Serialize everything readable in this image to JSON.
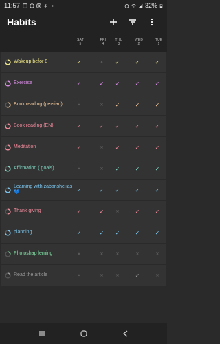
{
  "status_bar": {
    "time": "11:57",
    "battery_text": "32%"
  },
  "app_bar": {
    "title": "Habits"
  },
  "days": [
    {
      "dow": "SAT",
      "num": "5"
    },
    {
      "dow": "FRI",
      "num": "4"
    },
    {
      "dow": "THU",
      "num": "3"
    },
    {
      "dow": "WED",
      "num": "2"
    },
    {
      "dow": "TUE",
      "num": "1"
    }
  ],
  "habits": [
    {
      "name": "Wakeup befor 8",
      "color": "#f3eb8c",
      "progress": 0.75,
      "marks": [
        1,
        0,
        1,
        1,
        1
      ]
    },
    {
      "name": "Exercise",
      "color": "#d98ce6",
      "progress": 0.8,
      "marks": [
        1,
        1,
        1,
        1,
        1
      ]
    },
    {
      "name": "Book reading (persian)",
      "color": "#f2c597",
      "progress": 0.6,
      "marks": [
        0,
        0,
        1,
        1,
        1
      ]
    },
    {
      "name": "Book reading (EN)",
      "color": "#f08a9b",
      "progress": 0.8,
      "marks": [
        1,
        1,
        1,
        1,
        1
      ]
    },
    {
      "name": "Meditation",
      "color": "#f08a9b",
      "progress": 0.7,
      "marks": [
        1,
        0,
        1,
        1,
        1
      ]
    },
    {
      "name": "Affirmation ( goals)",
      "color": "#7fd6c2",
      "progress": 0.7,
      "marks": [
        0,
        0,
        1,
        1,
        1
      ]
    },
    {
      "name": "Learning with zabansheнas 💙",
      "color": "#7cc6ee",
      "progress": 0.75,
      "marks": [
        1,
        1,
        1,
        1,
        1
      ]
    },
    {
      "name": "Thank giving",
      "color": "#f08a9b",
      "progress": 0.5,
      "marks": [
        1,
        1,
        0,
        1,
        1
      ]
    },
    {
      "name": "planning",
      "color": "#7cc6ee",
      "progress": 0.7,
      "marks": [
        1,
        1,
        1,
        1,
        1
      ]
    },
    {
      "name": "Photoshap lerning",
      "color": "#7fe0a4",
      "progress": 0.25,
      "marks": [
        0,
        0,
        0,
        0,
        0
      ]
    },
    {
      "name": "Read the article",
      "color": "#9a9a9a",
      "progress": 0.2,
      "marks": [
        0,
        0,
        0,
        1,
        0
      ]
    }
  ],
  "colors": {
    "background": "#2a2a2a",
    "row": "#333333",
    "bar": "#222222"
  }
}
